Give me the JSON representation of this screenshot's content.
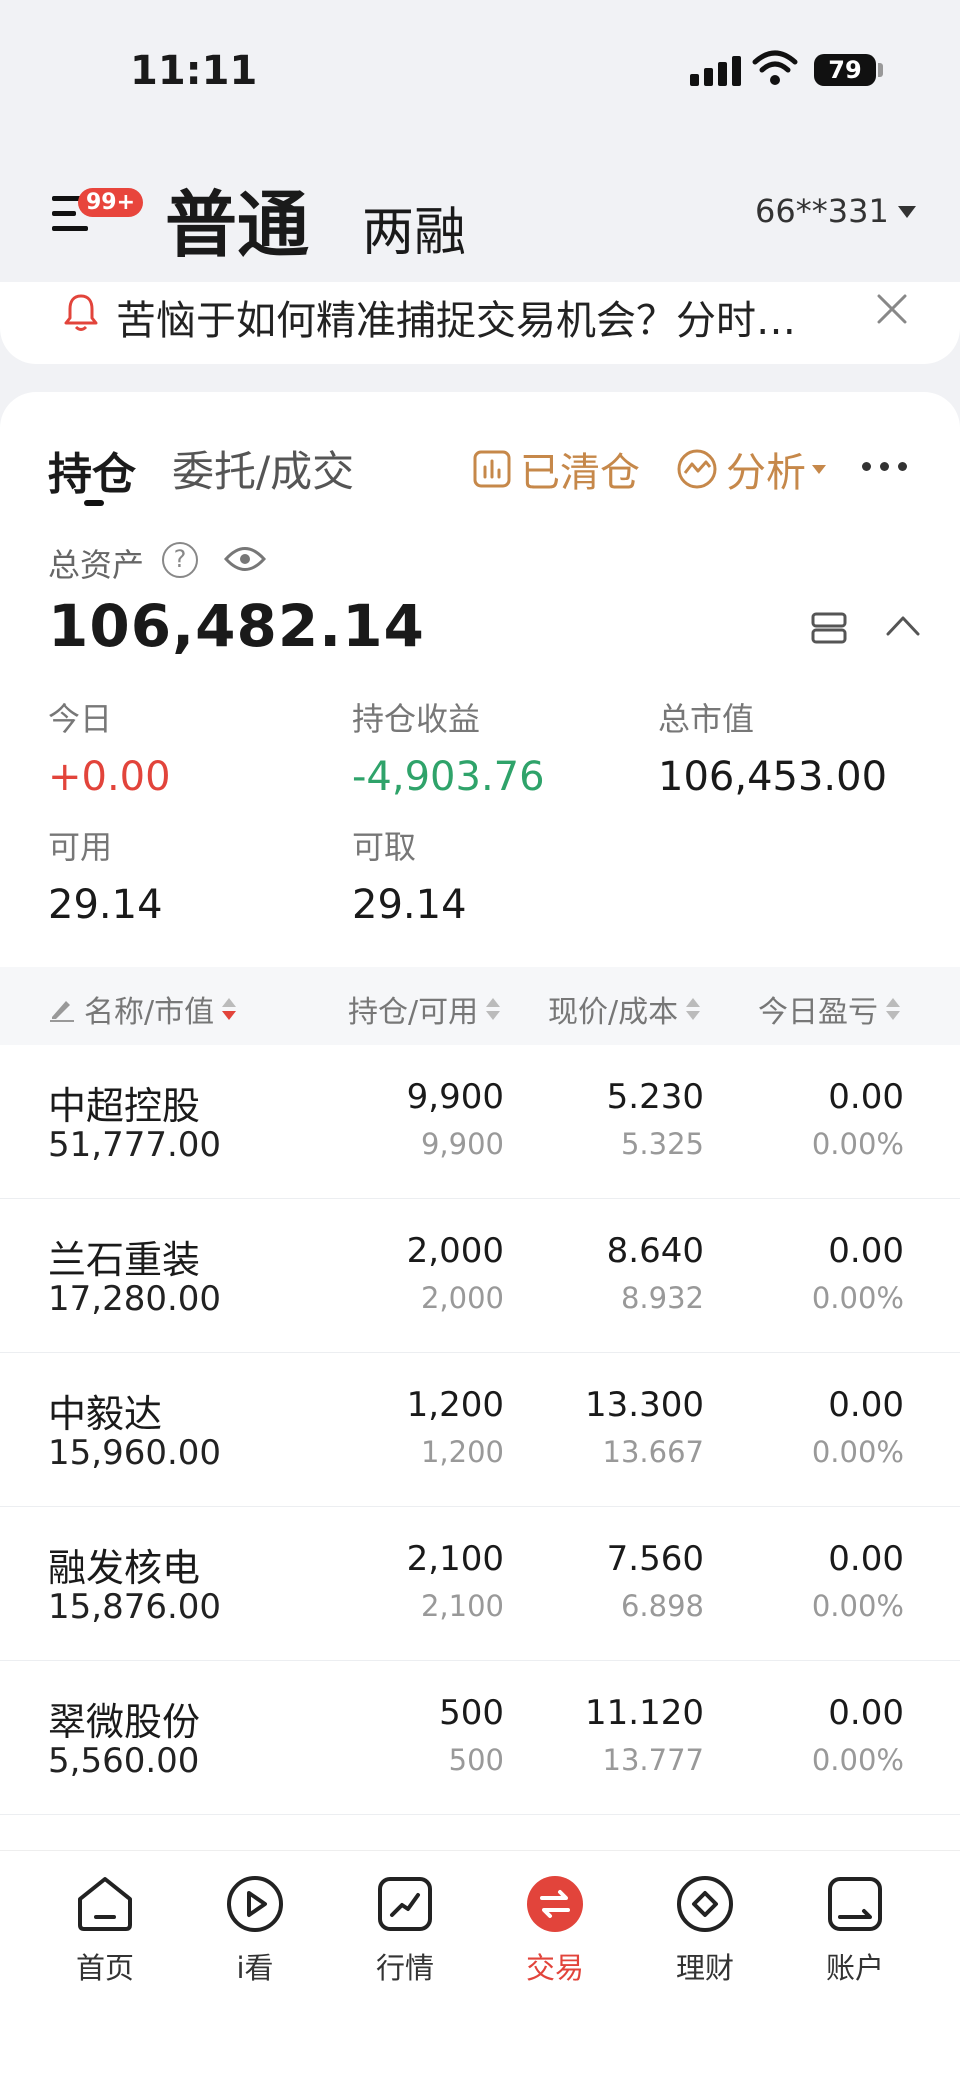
{
  "status_bar": {
    "time": "11:11",
    "battery": "79"
  },
  "header": {
    "badge": "99+",
    "tab_normal": "普通",
    "tab_margin": "两融",
    "account": "66**331"
  },
  "notice": {
    "text": "苦恼于如何精准捕捉交易机会？分时…"
  },
  "tabs": {
    "holdings": "持仓",
    "orders": "委托/成交"
  },
  "actions": {
    "cleared": "已清仓",
    "analysis": "分析"
  },
  "summary": {
    "total_assets_label": "总资产",
    "total_assets": "106,482.14",
    "today_label": "今日",
    "today_value": "+0.00",
    "holding_profit_label": "持仓收益",
    "holding_profit": "-4,903.76",
    "market_value_label": "总市值",
    "market_value": "106,453.00",
    "available_label": "可用",
    "available": "29.14",
    "withdrawable_label": "可取",
    "withdrawable": "29.14"
  },
  "table": {
    "headers": [
      "名称/市值",
      "持仓/可用",
      "现价/成本",
      "今日盈亏"
    ],
    "rows": [
      {
        "name": "中超控股",
        "mv": "51,777.00",
        "pos": "9,900",
        "avail": "9,900",
        "price": "5.230",
        "cost": "5.325",
        "pnl": "0.00",
        "pnl_pct": "0.00%"
      },
      {
        "name": "兰石重装",
        "mv": "17,280.00",
        "pos": "2,000",
        "avail": "2,000",
        "price": "8.640",
        "cost": "8.932",
        "pnl": "0.00",
        "pnl_pct": "0.00%"
      },
      {
        "name": "中毅达",
        "mv": "15,960.00",
        "pos": "1,200",
        "avail": "1,200",
        "price": "13.300",
        "cost": "13.667",
        "pnl": "0.00",
        "pnl_pct": "0.00%"
      },
      {
        "name": "融发核电",
        "mv": "15,876.00",
        "pos": "2,100",
        "avail": "2,100",
        "price": "7.560",
        "cost": "6.898",
        "pnl": "0.00",
        "pnl_pct": "0.00%"
      },
      {
        "name": "翠微股份",
        "mv": "5,560.00",
        "pos": "500",
        "avail": "500",
        "price": "11.120",
        "cost": "13.777",
        "pnl": "0.00",
        "pnl_pct": "0.00%"
      }
    ]
  },
  "nav": [
    {
      "label": "首页",
      "icon": "home-icon"
    },
    {
      "label": "i看",
      "icon": "play-icon"
    },
    {
      "label": "行情",
      "icon": "chart-icon"
    },
    {
      "label": "交易",
      "icon": "trade-icon",
      "active": true
    },
    {
      "label": "理财",
      "icon": "diamond-icon"
    },
    {
      "label": "账户",
      "icon": "account-icon"
    }
  ],
  "colors": {
    "red": "#e2443b",
    "green": "#2fa36a",
    "gold": "#c6884a"
  }
}
